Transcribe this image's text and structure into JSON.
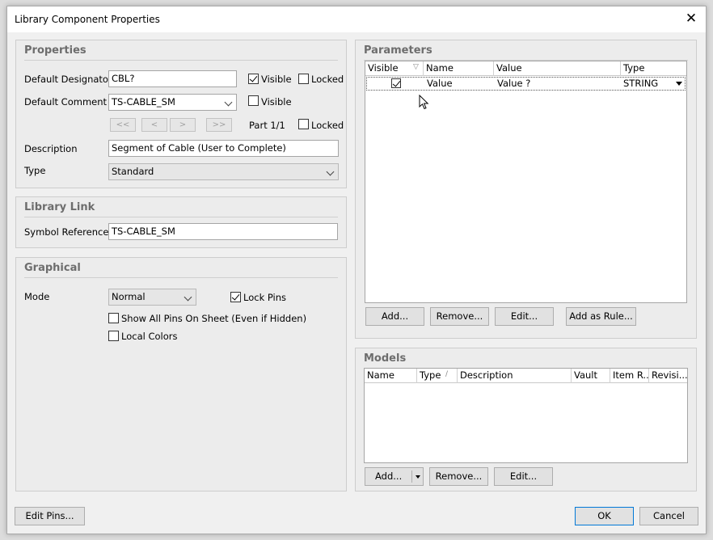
{
  "window": {
    "title": "Library Component Properties",
    "close_glyph": "✕"
  },
  "properties": {
    "title": "Properties",
    "designator_label": "Default Designator",
    "designator_value": "CBL?",
    "designator_visible_label": "Visible",
    "designator_locked_label": "Locked",
    "comment_label": "Default Comment",
    "comment_value": "TS-CABLE_SM",
    "comment_visible_label": "Visible",
    "nav": [
      "<<",
      "<",
      ">",
      ">>"
    ],
    "part_text": "Part 1/1",
    "part_locked_label": "Locked",
    "description_label": "Description",
    "description_value": "Segment of Cable (User to Complete)",
    "type_label": "Type",
    "type_value": "Standard"
  },
  "library_link": {
    "title": "Library Link",
    "symbol_ref_label": "Symbol Reference",
    "symbol_ref_value": "TS-CABLE_SM"
  },
  "graphical": {
    "title": "Graphical",
    "mode_label": "Mode",
    "mode_value": "Normal",
    "lock_pins_label": "Lock Pins",
    "show_all_pins_label": "Show All Pins On Sheet (Even if Hidden)",
    "local_colors_label": "Local Colors"
  },
  "parameters": {
    "title": "Parameters",
    "columns": [
      "Visible",
      "Name",
      "Value",
      "Type"
    ],
    "rows": [
      {
        "visible": true,
        "name": "Value",
        "value": "Value ?",
        "type": "STRING"
      }
    ],
    "buttons": [
      "Add...",
      "Remove...",
      "Edit...",
      "Add as Rule..."
    ]
  },
  "models": {
    "title": "Models",
    "columns": [
      "Name",
      "Type",
      "Description",
      "Vault",
      "Item R...",
      "Revisi..."
    ],
    "buttons": [
      "Add...",
      "Remove...",
      "Edit..."
    ]
  },
  "footer": {
    "edit_pins": "Edit Pins...",
    "ok": "OK",
    "cancel": "Cancel"
  }
}
